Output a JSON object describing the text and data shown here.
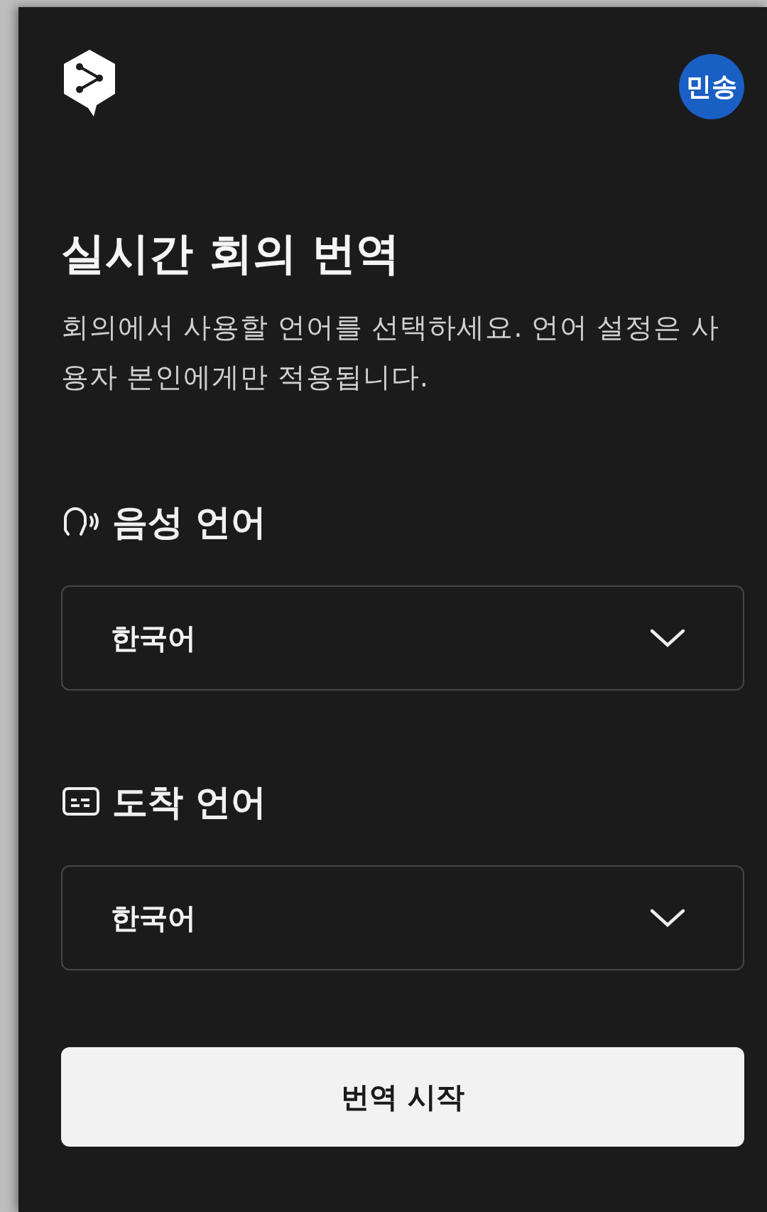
{
  "header": {
    "avatar": "민송"
  },
  "title": "실시간 회의 번역",
  "description": "회의에서 사용할 언어를 선택하세요. 언어 설정은 사용자 본인에게만 적용됩니다.",
  "languages": [
    {
      "kind": "voice",
      "label": "음성 언어",
      "value": "한국어"
    },
    {
      "kind": "target",
      "label": "도착 언어",
      "value": "한국어"
    }
  ],
  "start_button": "번역 시작"
}
